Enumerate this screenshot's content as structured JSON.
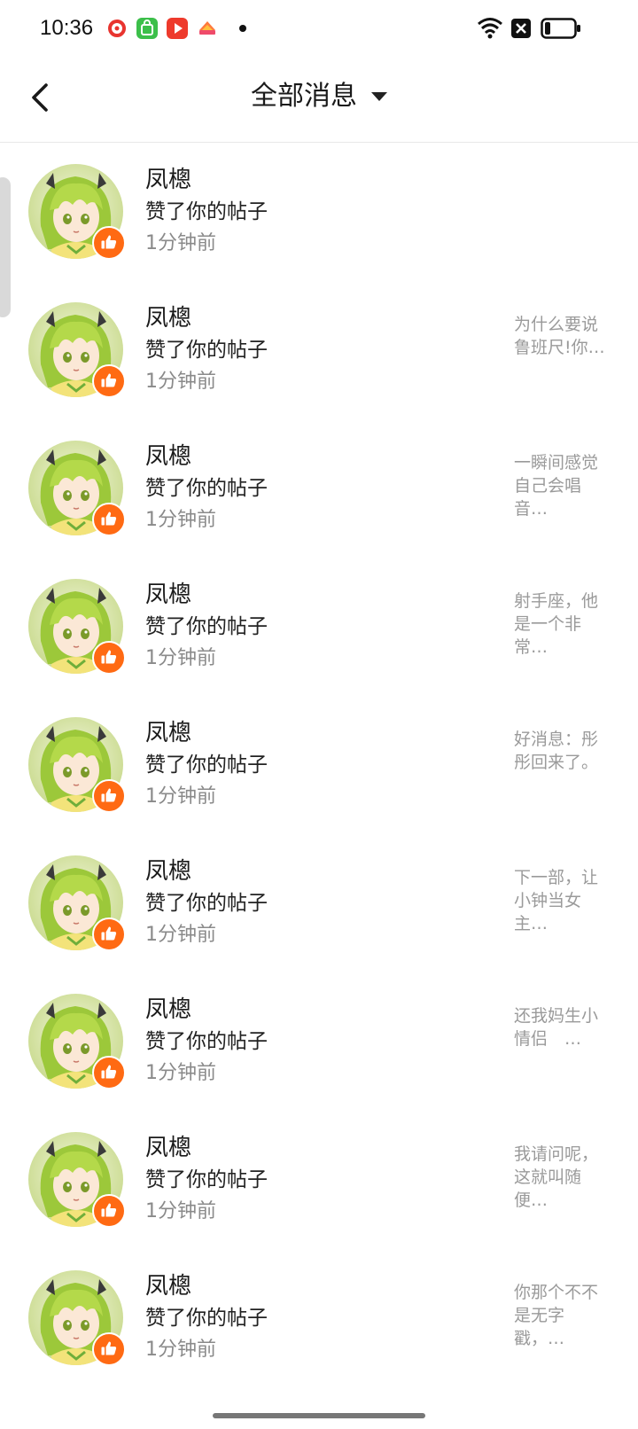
{
  "status_bar": {
    "time": "10:36",
    "app_icons": [
      "red-bubble-app-icon",
      "green-bag-app-icon",
      "red-play-app-icon",
      "colorful-app-icon"
    ],
    "right_icons": [
      "wifi-icon",
      "close-box-icon",
      "battery-icon"
    ]
  },
  "header": {
    "title": "全部消息",
    "back_icon": "chevron-left-icon",
    "dropdown_icon": "caret-down-icon"
  },
  "colors": {
    "like_badge": "#ff6a13",
    "secondary_text": "#8a8a8a",
    "preview_text": "#9a9a9a"
  },
  "messages": [
    {
      "user": "凤樬",
      "action": "赞了你的帖子",
      "time": "1分钟前",
      "preview": ""
    },
    {
      "user": "凤樬",
      "action": "赞了你的帖子",
      "time": "1分钟前",
      "preview": "为什么要说鲁班尺!你…"
    },
    {
      "user": "凤樬",
      "action": "赞了你的帖子",
      "time": "1分钟前",
      "preview": "一瞬间感觉自己会唱音…"
    },
    {
      "user": "凤樬",
      "action": "赞了你的帖子",
      "time": "1分钟前",
      "preview": "射手座，他是一个非常…"
    },
    {
      "user": "凤樬",
      "action": "赞了你的帖子",
      "time": "1分钟前",
      "preview": "好消息：彤彤回来了。"
    },
    {
      "user": "凤樬",
      "action": "赞了你的帖子",
      "time": "1分钟前",
      "preview": "下一部，让小钟当女主…"
    },
    {
      "user": "凤樬",
      "action": "赞了你的帖子",
      "time": "1分钟前",
      "preview": "还我妈生小情侣　…"
    },
    {
      "user": "凤樬",
      "action": "赞了你的帖子",
      "time": "1分钟前",
      "preview": "我请问呢，这就叫随便…"
    },
    {
      "user": "凤樬",
      "action": "赞了你的帖子",
      "time": "1分钟前",
      "preview": "你那个不不是无字戳，…"
    }
  ]
}
